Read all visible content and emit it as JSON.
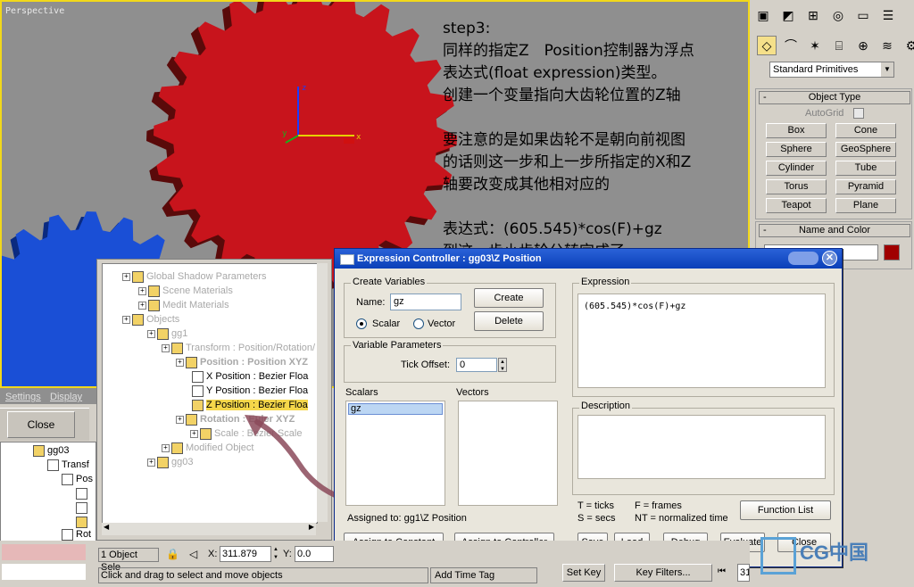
{
  "viewport": {
    "label": "Perspective",
    "gizmo": {
      "x": "x",
      "y": "y",
      "z": "z"
    },
    "notes": [
      "step3:",
      "同样的指定Z　Position控制器为浮点",
      "表达式(float expression)类型。",
      "创建一个变量指向大齿轮位置的Z轴",
      "",
      "要注意的是如果齿轮不是朝向前视图",
      "的话则这一步和上一步所指定的X和Z",
      "轴要改变成其他相对应的",
      "",
      "表达式：(605.545)*cos(F)+gz",
      "到这一步小齿轮公转完成了"
    ],
    "colors": {
      "big_gear": "#c8141c",
      "small_gear": "#1a4fd6"
    }
  },
  "command_panel": {
    "category": "Standard Primitives",
    "object_type_title": "Object Type",
    "autogrid": "AutoGrid",
    "buttons": [
      "Box",
      "Cone",
      "Sphere",
      "GeoSphere",
      "Cylinder",
      "Tube",
      "Torus",
      "Pyramid",
      "Teapot",
      "Plane"
    ],
    "name_color_title": "Name and Color",
    "swatch_color": "#a00000"
  },
  "left_panel": {
    "tabs": [
      "Settings",
      "Display"
    ],
    "close_label": "Close",
    "tree": [
      "gg03",
      "Transf",
      "Pos",
      "",
      "",
      "",
      "Rot"
    ]
  },
  "track_tree": {
    "rows": [
      {
        "label": "Global Shadow Parameters",
        "grey": true
      },
      {
        "label": "Scene Materials",
        "grey": true
      },
      {
        "label": "Medit Materials",
        "grey": true
      },
      {
        "label": "Objects",
        "grey": true
      },
      {
        "label": "gg1",
        "grey": true
      },
      {
        "label": "Transform : Position/Rotation/",
        "grey": true
      },
      {
        "label": "Position : Position XYZ",
        "grey": true,
        "bold": true
      },
      {
        "label": "X Position : Bezier Floa",
        "grey": false
      },
      {
        "label": "Y Position : Bezier Floa",
        "grey": false
      },
      {
        "label": "Z Position : Bezier Floa",
        "grey": false,
        "highlight": true
      },
      {
        "label": "Rotation : Euler XYZ",
        "grey": true,
        "bold": true
      },
      {
        "label": "Scale : Bezier Scale",
        "grey": true
      },
      {
        "label": "Modified Object",
        "grey": true
      },
      {
        "label": "gg03",
        "grey": true
      }
    ]
  },
  "dialog": {
    "title": "Expression Controller : gg03\\Z Position",
    "create_variables": "Create Variables",
    "name_label": "Name:",
    "name_value": "gz",
    "create": "Create",
    "delete": "Delete",
    "scalar": "Scalar",
    "vector": "Vector",
    "variable_parameters": "Variable Parameters",
    "tick_offset_label": "Tick Offset:",
    "tick_offset_value": "0",
    "scalars_label": "Scalars",
    "vectors_label": "Vectors",
    "scalars": [
      "gz"
    ],
    "assigned_to": "Assigned to: gg1\\Z Position",
    "assign_constant": "Assign to Constant",
    "assign_controller": "Assign to Controller",
    "expression_label": "Expression",
    "expression": "(605.545)*cos(F)+gz",
    "description_label": "Description",
    "legend": [
      "T = ticks",
      "F = frames",
      "S = secs",
      "NT = normalized time"
    ],
    "function_list": "Function List",
    "save": "Save",
    "load": "Load",
    "debug": "Debug",
    "evaluate": "Evaluate",
    "close": "Close"
  },
  "status": {
    "selection": "1 Object Sele",
    "x_label": "X:",
    "x_value": "311.879",
    "y_label": "Y:",
    "y_value": "0.0",
    "prompt": "Click and drag to select and move objects",
    "add_time_tag": "Add Time Tag",
    "set_key": "Set Key",
    "key_filters": "Key Filters...",
    "frame": "31"
  },
  "watermark": "CG中国"
}
